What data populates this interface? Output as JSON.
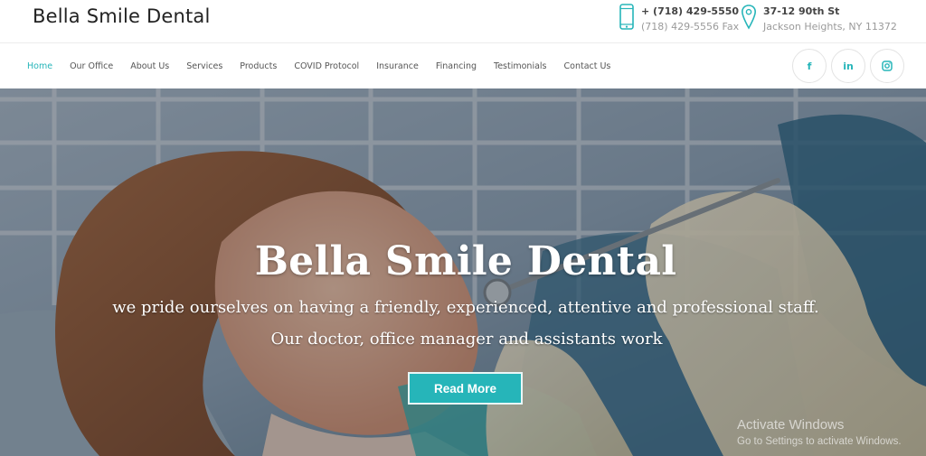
{
  "brand": {
    "name": "Bella Smile Dental",
    "accent": "#26b5b9"
  },
  "contact": {
    "phone": "+ (718) 429-5550",
    "fax": "(718) 429-5556 Fax",
    "street": "37-12 90th St",
    "city": "Jackson Heights, NY 11372",
    "phone_icon": "mobile-phone-icon",
    "address_icon": "map-pin-icon"
  },
  "nav": {
    "items": [
      {
        "label": "Home",
        "active": true
      },
      {
        "label": "Our Office"
      },
      {
        "label": "About Us"
      },
      {
        "label": "Services"
      },
      {
        "label": "Products"
      },
      {
        "label": "COVID Protocol"
      },
      {
        "label": "Insurance"
      },
      {
        "label": "Financing"
      },
      {
        "label": "Testimonials"
      },
      {
        "label": "Contact Us"
      }
    ]
  },
  "social": [
    {
      "icon": "facebook-icon",
      "glyph": "f"
    },
    {
      "icon": "linkedin-icon",
      "glyph": "in"
    },
    {
      "icon": "instagram-icon",
      "glyph": ""
    }
  ],
  "hero": {
    "title": "Bella Smile Dental",
    "line1": "we pride ourselves on having a friendly, experienced, attentive and professional staff.",
    "line2": "Our doctor, office manager and assistants work",
    "button": "Read More"
  },
  "watermark": {
    "line1": "Activate Windows",
    "line2": "Go to Settings to activate Windows."
  }
}
